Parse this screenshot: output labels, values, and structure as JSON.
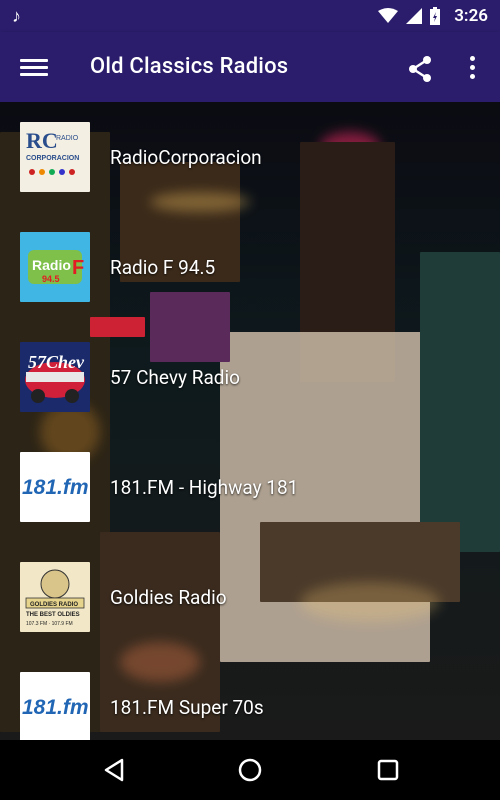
{
  "status_bar": {
    "time": "3:26",
    "icons": [
      "music-note-icon",
      "wifi-icon",
      "signal-icon",
      "battery-charging-icon"
    ]
  },
  "app_bar": {
    "title": "Old Classics Radios",
    "menu_icon": "hamburger-menu-icon",
    "share_icon": "share-icon",
    "more_icon": "more-vert-icon"
  },
  "stations": [
    {
      "name": "RadioCorporacion",
      "logo_text": "RC RADIO CORPORACION"
    },
    {
      "name": "Radio F 94.5",
      "logo_text": "Radio F 94.5"
    },
    {
      "name": "57 Chevy Radio",
      "logo_text": "57 Chevy"
    },
    {
      "name": "181.FM - Highway 181",
      "logo_text": "181.fm"
    },
    {
      "name": "Goldies Radio",
      "logo_text": "GOLDIES RADIO THE BEST OLDIES"
    },
    {
      "name": "181.FM Super 70s",
      "logo_text": "181.fm"
    }
  ],
  "nav_bar": {
    "icons": [
      "back-icon",
      "home-icon",
      "recents-icon"
    ]
  },
  "colors": {
    "app_bar": "#2b1d6b",
    "label_text": "#ffffff"
  }
}
